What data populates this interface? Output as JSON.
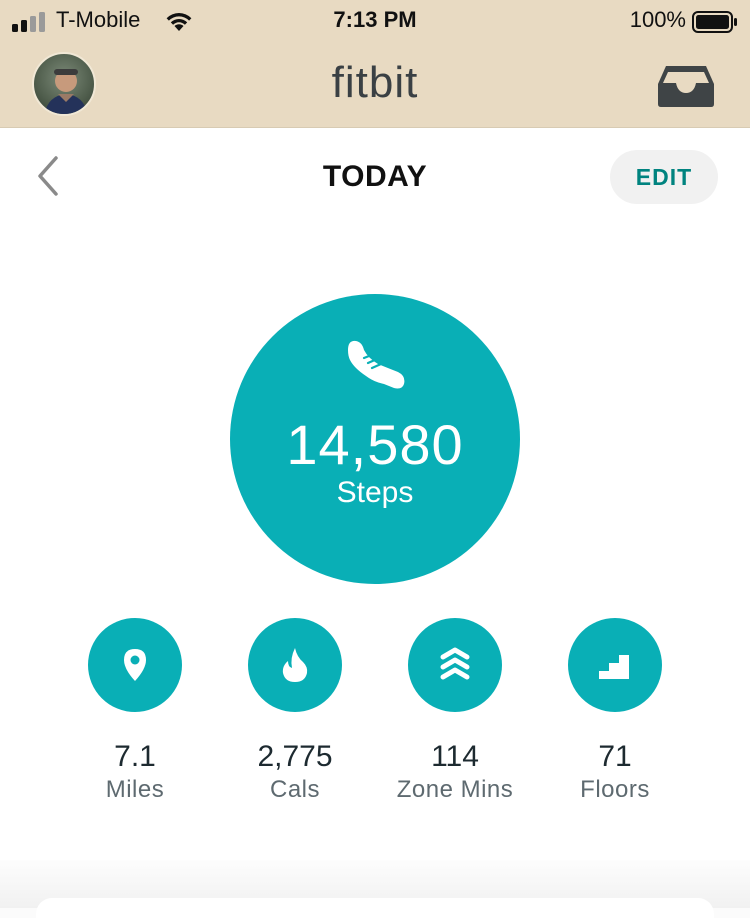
{
  "status_bar": {
    "carrier": "T-Mobile",
    "time": "7:13 PM",
    "battery_percent": "100%",
    "signal_bars": 2
  },
  "header": {
    "brand": "fitbit",
    "avatar_icon": "user-avatar",
    "inbox_icon": "inbox-icon",
    "background_color": "#e8dac2"
  },
  "nav": {
    "title": "TODAY",
    "edit_label": "EDIT",
    "back_icon": "chevron-left-icon"
  },
  "steps": {
    "value": "14,580",
    "label": "Steps",
    "icon": "shoe-icon",
    "color": "#09afb6"
  },
  "stats": [
    {
      "value": "7.1",
      "label": "Miles",
      "icon": "location-pin-icon"
    },
    {
      "value": "2,775",
      "label": "Cals",
      "icon": "flame-icon"
    },
    {
      "value": "114",
      "label": "Zone Mins",
      "icon": "zone-chevrons-icon"
    },
    {
      "value": "71",
      "label": "Floors",
      "icon": "stairs-icon"
    }
  ]
}
